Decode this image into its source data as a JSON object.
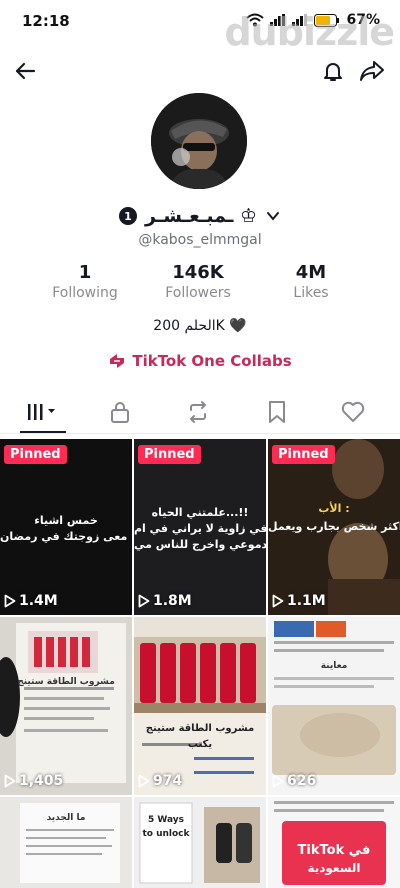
{
  "status_bar": {
    "time": "12:18",
    "battery": "67%"
  },
  "watermark": "dubizzle",
  "profile": {
    "username": "ـمبـعـشـر ♔",
    "username_badge": "1",
    "handle": "@kabos_elmmgal",
    "bio": "الحلم 200K 🖤",
    "collabs_label": "TikTok One Collabs"
  },
  "stats": {
    "following_count": "1",
    "following_label": "Following",
    "followers_count": "146K",
    "followers_label": "Followers",
    "likes_count": "4M",
    "likes_label": "Likes"
  },
  "tabs": [
    "videos-grid",
    "private",
    "reposts",
    "favorites",
    "liked"
  ],
  "videos": [
    {
      "pinned": "Pinned",
      "views": "1.4M",
      "caption": [
        "خمس اشياء",
        "ان تعطلها معى زوجتك في رمضان"
      ]
    },
    {
      "pinned": "Pinned",
      "views": "1.8M",
      "caption": [
        "علمتني الحياه...!!",
        "كي في زاوية لا يراني في ام",
        "ج دموعي واخرج للناس مي"
      ]
    },
    {
      "pinned": "Pinned",
      "views": "1.1M",
      "caption": [
        "الأب :",
        "نا اكثر شخص بجارب ويعمل"
      ]
    },
    {
      "views": "1,405",
      "caption": [
        "مشروب الطاقة ستينج"
      ]
    },
    {
      "views": "974",
      "caption": [
        "مشروب الطاقة ستينج",
        "يكتب"
      ]
    },
    {
      "views": "626",
      "caption": [
        "معاينة"
      ]
    },
    {
      "caption": [
        "ما الجديد"
      ]
    },
    {
      "caption": [
        "5 Ways",
        "to unlock"
      ]
    },
    {
      "caption": [
        "TikTok في",
        "السعودية"
      ]
    }
  ],
  "colors": {
    "accent": "#fe2c55",
    "collabs": "#c8295a",
    "text_primary": "#161823",
    "text_secondary": "#8a8b91"
  }
}
